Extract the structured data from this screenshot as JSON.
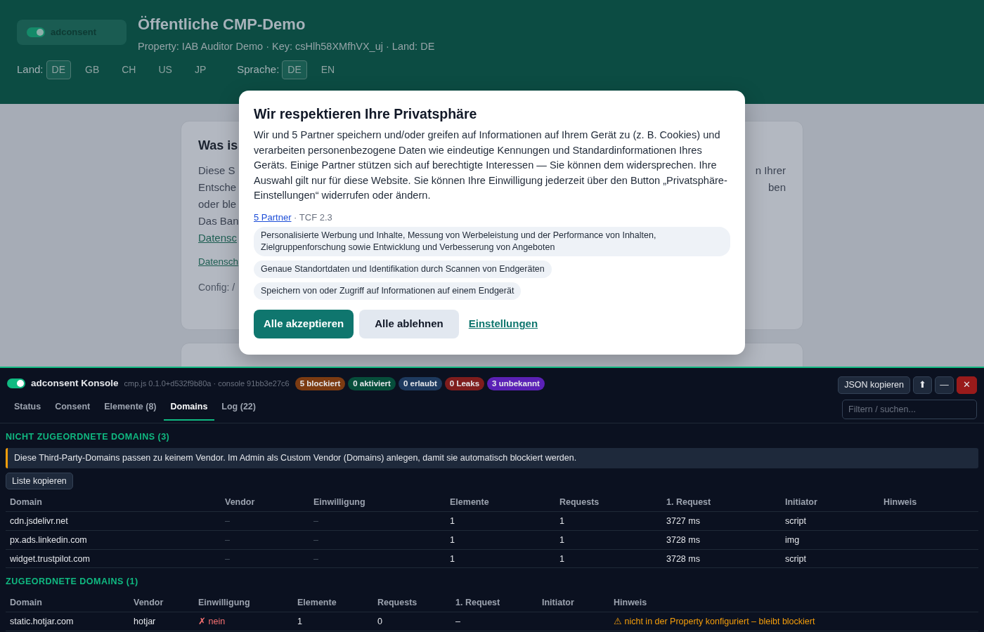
{
  "site": {
    "logo": "adconsent",
    "title": "Öffentliche CMP-Demo",
    "subtitle": "Property: IAB Auditor Demo · Key: csHlh58XMfhVX_uj · Land: DE",
    "country_label": "Land:",
    "countries": [
      {
        "label": "DE",
        "selected": true
      },
      {
        "label": "GB",
        "selected": false
      },
      {
        "label": "CH",
        "selected": false
      },
      {
        "label": "US",
        "selected": false
      },
      {
        "label": "JP",
        "selected": false
      }
    ],
    "language_label": "Sprache:",
    "languages": [
      {
        "label": "DE",
        "selected": true
      },
      {
        "label": "EN",
        "selected": false
      }
    ]
  },
  "background_card": {
    "rows": [
      {
        "kind": "heading",
        "left": "Was is"
      },
      {
        "kind": "text",
        "left": "Diese S",
        "right": "n Ihrer"
      },
      {
        "kind": "text",
        "left": "Entsche",
        "right": "ben"
      },
      {
        "kind": "text",
        "left": "oder ble"
      },
      {
        "kind": "text",
        "left": "Das Ban"
      },
      {
        "kind": "link",
        "left": "Datensc"
      },
      {
        "kind": "small-link",
        "left": "Datensch"
      },
      {
        "kind": "muted",
        "left": "Config: /"
      }
    ]
  },
  "consent_dialog": {
    "title": "Wir respektieren Ihre Privatsphäre",
    "text": "Wir und 5 Partner speichern und/oder greifen auf Informationen auf Ihrem Gerät zu (z. B. Cookies) und verarbeiten personenbezogene Daten wie eindeutige Kennungen und Standardinformationen Ihres Geräts. Einige Partner stützen sich auf berechtigte Interessen — Sie können dem widersprechen. Ihre Auswahl gilt nur für diese Website. Sie können Ihre Einwilligung jederzeit über den Button „Privatsphäre-Einstellungen“ widerrufen oder ändern.",
    "partners_link": "5 Partner",
    "tcf": "· TCF 2.3",
    "purposes": [
      "Personalisierte Werbung und Inhalte, Messung von Werbeleistung und der Performance von Inhalten, Zielgruppenforschung sowie Entwicklung und Verbesserung von Angeboten",
      "Genaue Standortdaten und Identifikation durch Scannen von Endgeräten",
      "Speichern von oder Zugriff auf Informationen auf einem Endgerät"
    ],
    "buttons": [
      {
        "kind": "primary",
        "label": "Alle akzeptieren"
      },
      {
        "kind": "secondary",
        "label": "Alle ablehnen"
      },
      {
        "kind": "link",
        "label": "Einstellungen"
      }
    ]
  },
  "console": {
    "enabled": true,
    "title": "adconsent Konsole",
    "version": "cmp.js 0.1.0+d532f9b80a · console 91bb3e27c6",
    "badges": [
      {
        "label": "5 blockiert",
        "color": "#7c3b12"
      },
      {
        "label": "0 aktiviert",
        "color": "#064e3b"
      },
      {
        "label": "0 erlaubt",
        "color": "#1e3a5f"
      },
      {
        "label": "0 Leaks",
        "color": "#7f1d1d"
      },
      {
        "label": "3 unbekannt",
        "color": "#5b21b6"
      }
    ],
    "actions": [
      {
        "kind": "text",
        "label": "JSON kopieren"
      },
      {
        "kind": "icon",
        "label": "⬆"
      },
      {
        "kind": "icon",
        "label": "—"
      },
      {
        "kind": "danger",
        "label": "✕"
      }
    ],
    "tabs": [
      {
        "label": "Status",
        "selected": false
      },
      {
        "label": "Consent",
        "selected": false
      },
      {
        "label": "Elemente (8)",
        "selected": false
      },
      {
        "label": "Domains",
        "selected": true
      },
      {
        "label": "Log (22)",
        "selected": false
      }
    ],
    "filter": {
      "placeholder": "Filtern / suchen..."
    },
    "sections": [
      {
        "title": "NICHT ZUGEORDNETE DOMAINS (3)",
        "notice": "Diese Third-Party-Domains passen zu keinem Vendor. Im Admin als Custom Vendor (Domains) anlegen, damit sie automatisch blockiert werden.",
        "button": "Liste kopieren",
        "columns": [
          "Domain",
          "Vendor",
          "Einwilligung",
          "Elemente",
          "Requests",
          "1. Request",
          "Initiator",
          "Hinweis"
        ],
        "rows": [
          {
            "cells": [
              "cdn.jsdelivr.net",
              {
                "text": "–",
                "kind": "muted"
              },
              {
                "text": "–",
                "kind": "muted"
              },
              "1",
              "1",
              "3727 ms",
              "script",
              ""
            ]
          },
          {
            "cells": [
              "px.ads.linkedin.com",
              {
                "text": "–",
                "kind": "muted"
              },
              {
                "text": "–",
                "kind": "muted"
              },
              "1",
              "1",
              "3728 ms",
              "img",
              ""
            ]
          },
          {
            "cells": [
              "widget.trustpilot.com",
              {
                "text": "–",
                "kind": "muted"
              },
              {
                "text": "–",
                "kind": "muted"
              },
              "1",
              "1",
              "3728 ms",
              "script",
              ""
            ]
          }
        ]
      },
      {
        "title": "ZUGEORDNETE DOMAINS (1)",
        "columns": [
          "Domain",
          "Vendor",
          "Einwilligung",
          "Elemente",
          "Requests",
          "1. Request",
          "Initiator",
          "Hinweis"
        ],
        "rows": [
          {
            "cells": [
              "static.hotjar.com",
              "hotjar",
              {
                "text": "✗ nein",
                "kind": "denied"
              },
              "1",
              "0",
              "–",
              "",
              {
                "text": "⚠ nicht in der Property konfiguriert – bleibt blockiert",
                "kind": "warning"
              }
            ]
          }
        ]
      }
    ]
  }
}
